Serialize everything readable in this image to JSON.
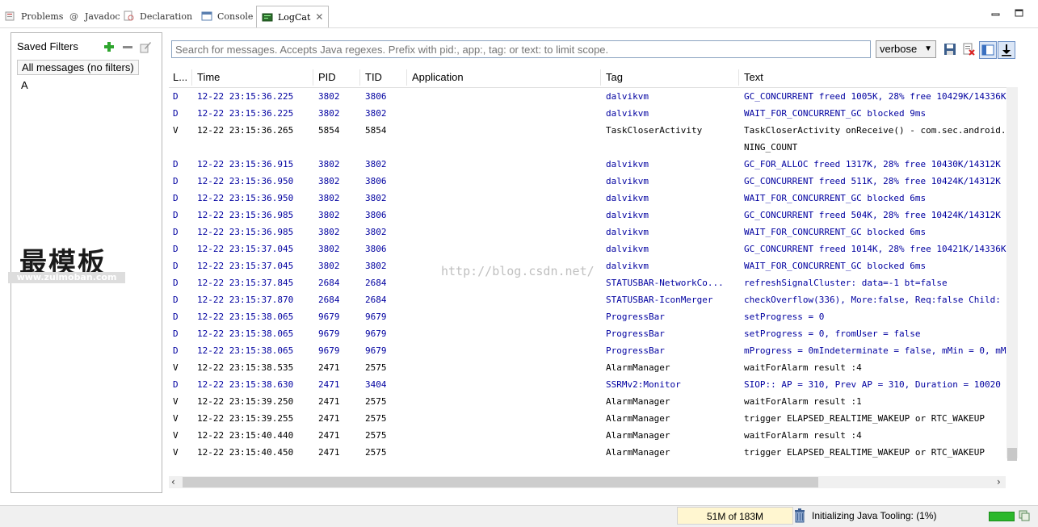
{
  "tabs": [
    {
      "label": "Problems",
      "icon": "problems-icon"
    },
    {
      "label": "Javadoc",
      "icon": "javadoc-icon"
    },
    {
      "label": "Declaration",
      "icon": "declaration-icon"
    },
    {
      "label": "Console",
      "icon": "console-icon"
    },
    {
      "label": "LogCat",
      "icon": "logcat-icon",
      "active": true
    }
  ],
  "sidebar": {
    "title": "Saved Filters",
    "items": [
      {
        "label": "All messages (no filters)"
      },
      {
        "label": "A"
      }
    ]
  },
  "watermark": {
    "text": "最模板",
    "url": "www.zuimoban.com"
  },
  "overlay_watermark": "http://blog.csdn.net/",
  "search": {
    "placeholder": "Search for messages. Accepts Java regexes. Prefix with pid:, app:, tag: or text: to limit scope."
  },
  "level": {
    "selected": "verbose"
  },
  "columns": [
    "L...",
    "Time",
    "PID",
    "TID",
    "Application",
    "Tag",
    "Text"
  ],
  "rows": [
    {
      "level": "D",
      "time": "12-22 23:15:36.225",
      "pid": "3802",
      "tid": "3806",
      "app": "",
      "tag": "dalvikvm",
      "text": "GC_CONCURRENT freed 1005K, 28% free 10429K/14336K"
    },
    {
      "level": "D",
      "time": "12-22 23:15:36.225",
      "pid": "3802",
      "tid": "3802",
      "app": "",
      "tag": "dalvikvm",
      "text": "WAIT_FOR_CONCURRENT_GC blocked 9ms"
    },
    {
      "level": "V",
      "time": "12-22 23:15:36.265",
      "pid": "5854",
      "tid": "5854",
      "app": "",
      "tag": "TaskCloserActivity",
      "text": "TaskCloserActivity onReceive() - com.sec.android.",
      "cont": "NING_COUNT"
    },
    {
      "level": "D",
      "time": "12-22 23:15:36.915",
      "pid": "3802",
      "tid": "3802",
      "app": "",
      "tag": "dalvikvm",
      "text": "GC_FOR_ALLOC freed 1317K, 28% free 10430K/14312K"
    },
    {
      "level": "D",
      "time": "12-22 23:15:36.950",
      "pid": "3802",
      "tid": "3806",
      "app": "",
      "tag": "dalvikvm",
      "text": "GC_CONCURRENT freed 511K, 28% free 10424K/14312K"
    },
    {
      "level": "D",
      "time": "12-22 23:15:36.950",
      "pid": "3802",
      "tid": "3802",
      "app": "",
      "tag": "dalvikvm",
      "text": "WAIT_FOR_CONCURRENT_GC blocked 6ms"
    },
    {
      "level": "D",
      "time": "12-22 23:15:36.985",
      "pid": "3802",
      "tid": "3806",
      "app": "",
      "tag": "dalvikvm",
      "text": "GC_CONCURRENT freed 504K, 28% free 10424K/14312K"
    },
    {
      "level": "D",
      "time": "12-22 23:15:36.985",
      "pid": "3802",
      "tid": "3802",
      "app": "",
      "tag": "dalvikvm",
      "text": "WAIT_FOR_CONCURRENT_GC blocked 6ms"
    },
    {
      "level": "D",
      "time": "12-22 23:15:37.045",
      "pid": "3802",
      "tid": "3806",
      "app": "",
      "tag": "dalvikvm",
      "text": "GC_CONCURRENT freed 1014K, 28% free 10421K/14336K"
    },
    {
      "level": "D",
      "time": "12-22 23:15:37.045",
      "pid": "3802",
      "tid": "3802",
      "app": "",
      "tag": "dalvikvm",
      "text": "WAIT_FOR_CONCURRENT_GC blocked 6ms"
    },
    {
      "level": "D",
      "time": "12-22 23:15:37.845",
      "pid": "2684",
      "tid": "2684",
      "app": "",
      "tag": "STATUSBAR-NetworkCo...",
      "text": "refreshSignalCluster: data=-1 bt=false"
    },
    {
      "level": "D",
      "time": "12-22 23:15:37.870",
      "pid": "2684",
      "tid": "2684",
      "app": "",
      "tag": "STATUSBAR-IconMerger",
      "text": "checkOverflow(336), More:false, Req:false Child:"
    },
    {
      "level": "D",
      "time": "12-22 23:15:38.065",
      "pid": "9679",
      "tid": "9679",
      "app": "",
      "tag": "ProgressBar",
      "text": "setProgress = 0"
    },
    {
      "level": "D",
      "time": "12-22 23:15:38.065",
      "pid": "9679",
      "tid": "9679",
      "app": "",
      "tag": "ProgressBar",
      "text": "setProgress = 0, fromUser = false"
    },
    {
      "level": "D",
      "time": "12-22 23:15:38.065",
      "pid": "9679",
      "tid": "9679",
      "app": "",
      "tag": "ProgressBar",
      "text": "mProgress = 0mIndeterminate = false, mMin = 0, mM"
    },
    {
      "level": "V",
      "time": "12-22 23:15:38.535",
      "pid": "2471",
      "tid": "2575",
      "app": "",
      "tag": "AlarmManager",
      "text": "waitForAlarm result :4"
    },
    {
      "level": "D",
      "time": "12-22 23:15:38.630",
      "pid": "2471",
      "tid": "3404",
      "app": "",
      "tag": "SSRMv2:Monitor",
      "text": "SIOP:: AP = 310, Prev AP = 310, Duration = 10020"
    },
    {
      "level": "V",
      "time": "12-22 23:15:39.250",
      "pid": "2471",
      "tid": "2575",
      "app": "",
      "tag": "AlarmManager",
      "text": "waitForAlarm result :1"
    },
    {
      "level": "V",
      "time": "12-22 23:15:39.255",
      "pid": "2471",
      "tid": "2575",
      "app": "",
      "tag": "AlarmManager",
      "text": "trigger ELAPSED_REALTIME_WAKEUP or RTC_WAKEUP"
    },
    {
      "level": "V",
      "time": "12-22 23:15:40.440",
      "pid": "2471",
      "tid": "2575",
      "app": "",
      "tag": "AlarmManager",
      "text": "waitForAlarm result :4"
    },
    {
      "level": "V",
      "time": "12-22 23:15:40.450",
      "pid": "2471",
      "tid": "2575",
      "app": "",
      "tag": "AlarmManager",
      "text": "trigger ELAPSED_REALTIME_WAKEUP or RTC_WAKEUP"
    }
  ],
  "status": {
    "memory": "51M of 183M",
    "memory_used_fraction": 0.28,
    "message": "Initializing Java Tooling: (1%)",
    "progress_percent": 1
  },
  "colors": {
    "debug": "#0000a0",
    "verbose": "#000000",
    "add_green": "#2ea52e",
    "accent": "#3a70c0"
  }
}
